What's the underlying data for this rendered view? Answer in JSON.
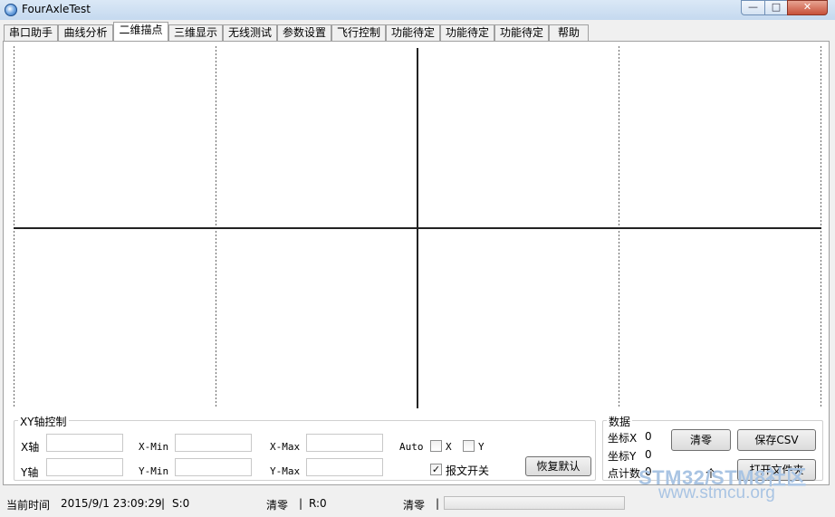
{
  "window": {
    "title": "FourAxleTest",
    "min_label": "—",
    "max_label": "□",
    "close_label": "✕"
  },
  "tabs": [
    {
      "label": "串口助手"
    },
    {
      "label": "曲线分析"
    },
    {
      "label": "二维描点"
    },
    {
      "label": "三维显示"
    },
    {
      "label": "无线测试"
    },
    {
      "label": "参数设置"
    },
    {
      "label": "飞行控制"
    },
    {
      "label": "功能待定"
    },
    {
      "label": "功能待定"
    },
    {
      "label": "功能待定"
    },
    {
      "label": "帮助"
    }
  ],
  "active_tab": "二维描点",
  "xy_control": {
    "title": "XY轴控制",
    "x_axis_label": "X轴",
    "y_axis_label": "Y轴",
    "x_min_label": "X-Min",
    "y_min_label": "Y-Min",
    "x_max_label": "X-Max",
    "y_max_label": "Y-Max",
    "x_axis_value": "",
    "y_axis_value": "",
    "x_min_value": "",
    "y_min_value": "",
    "x_max_value": "",
    "y_max_value": "",
    "auto_label": "Auto",
    "auto_x_label": "X",
    "auto_y_label": "Y",
    "auto_x_checked": false,
    "auto_y_checked": false,
    "report_switch_label": "报文开关",
    "report_switch_checked": true,
    "restore_button": "恢复默认"
  },
  "data_panel": {
    "title": "数据",
    "coord_x_label": "坐标X",
    "coord_x_value": "0",
    "coord_y_label": "坐标Y",
    "coord_y_value": "0",
    "point_count_label": "点计数",
    "point_count_value": "0",
    "point_unit": "个",
    "clear_button": "清零",
    "save_csv_button": "保存CSV",
    "open_folder_button": "打开文件夹"
  },
  "status_bar": {
    "time_label": "当前时间",
    "time_value": "2015/9/1 23:09:29",
    "sep": "|",
    "send_count": "S:0",
    "clear_send": "清零",
    "recv_count": "R:0",
    "clear_recv": "清零",
    "progress": 0
  },
  "watermark": {
    "brand": "STM32/STM8社区",
    "url": "www.stmcu.org"
  }
}
